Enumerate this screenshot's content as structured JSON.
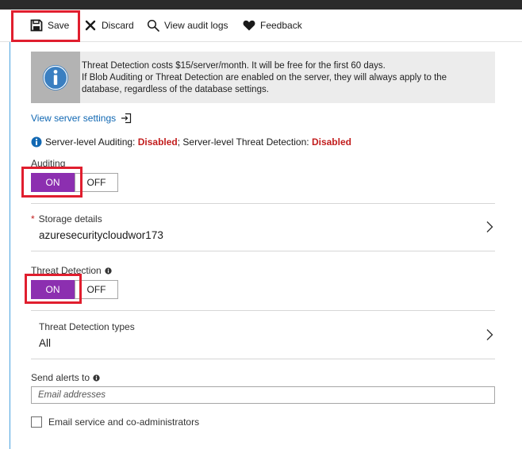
{
  "toolbar": {
    "save_label": "Save",
    "discard_label": "Discard",
    "audit_logs_label": "View audit logs",
    "feedback_label": "Feedback",
    "icons": [
      "save-icon",
      "discard-icon",
      "search-icon",
      "heart-icon"
    ]
  },
  "banner": {
    "icon": "info-icon",
    "line1": "Threat Detection costs $15/server/month. It will be free for the first 60 days.",
    "line2": "If Blob Auditing or Threat Detection are enabled on the server, they will always apply to the",
    "line3": "database, regardless of the database settings."
  },
  "server_settings": {
    "link_label": "View server settings",
    "icon": "open-blade-icon"
  },
  "server_status": {
    "auditing_prefix": "Server-level Auditing: ",
    "auditing_value": "Disabled",
    "separator": "; Server-level Threat Detection: ",
    "threat_value": "Disabled",
    "status_color": "#c21d1d"
  },
  "auditing": {
    "label": "Auditing",
    "on_label": "ON",
    "off_label": "OFF",
    "state": "ON"
  },
  "storage": {
    "required_marker": "*",
    "title": "Storage details",
    "value": "azuresecuritycloudwor173"
  },
  "threat_detection": {
    "label": "Threat Detection",
    "on_label": "ON",
    "off_label": "OFF",
    "state": "ON"
  },
  "threat_types": {
    "title": "Threat Detection types",
    "value": "All"
  },
  "alerts": {
    "label": "Send alerts to",
    "placeholder": "Email addresses"
  },
  "email_admins": {
    "label": "Email service and co-administrators",
    "checked": false
  },
  "colors": {
    "toggle_on": "#8c2fb0",
    "highlight": "#e01e2e",
    "link": "#1168b3"
  }
}
